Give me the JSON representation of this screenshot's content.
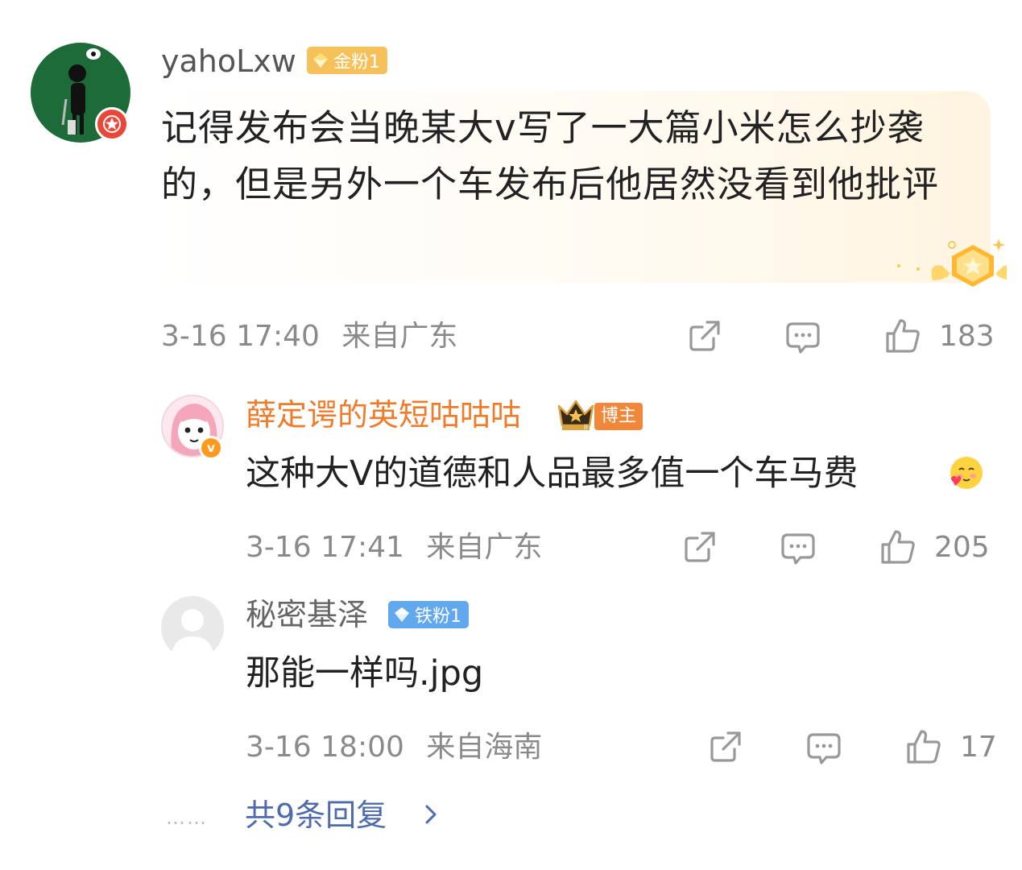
{
  "main_comment": {
    "username": "yahoLxw",
    "fan_badge": "金粉1",
    "text": "记得发布会当晚某大v写了一大篇小米怎么抄袭的，但是另外一个车发布后他居然没看到他批评",
    "time": "3-16 17:40",
    "location": "来自广东",
    "likes": "183",
    "icons": [
      "share-icon",
      "comment-icon",
      "like-icon",
      "medal-icon"
    ]
  },
  "replies": [
    {
      "username": "薛定谔的英短咕咕咕",
      "badge": "博主",
      "text": "这种大V的道德和人品最多值一个车马费",
      "time": "3-16 17:41",
      "location": "来自广东",
      "likes": "205",
      "verified": "v"
    },
    {
      "username": "秘密基泽",
      "fan_badge": "铁粉1",
      "text": "那能一样吗.jpg",
      "time": "3-16 18:00",
      "location": "来自海南",
      "likes": "17"
    }
  ],
  "footer": {
    "dots": "……",
    "more_replies": "共9条回复"
  },
  "colors": {
    "name_orange": "#ef7b2b",
    "link_blue": "#4f6bae",
    "gold_badge": "#f6c15a",
    "blue_badge": "#62a8ef",
    "blogger_badge": "#f0873a"
  }
}
